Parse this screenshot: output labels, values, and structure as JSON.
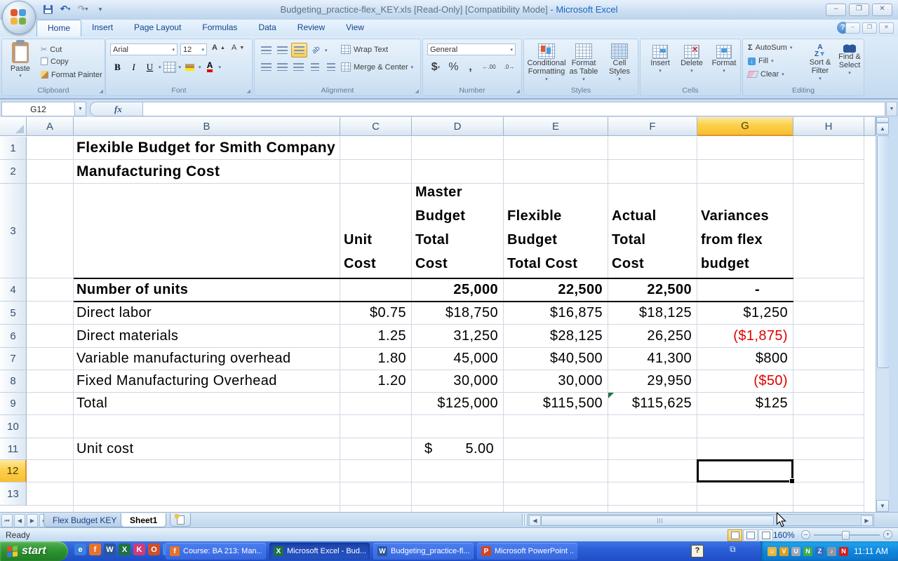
{
  "window": {
    "doc_title": "Budgeting_practice-flex_KEY.xls  [Read-Only]  [Compatibility Mode] ",
    "app_name": "- Microsoft Excel",
    "controls": {
      "minimize": "–",
      "restore": "❐",
      "close": "✕"
    }
  },
  "ribbon_tabs": [
    "Home",
    "Insert",
    "Page Layout",
    "Formulas",
    "Data",
    "Review",
    "View"
  ],
  "active_tab": "Home",
  "ribbon": {
    "clipboard": {
      "label": "Clipboard",
      "paste": "Paste",
      "cut": "Cut",
      "copy": "Copy",
      "format_painter": "Format Painter"
    },
    "font": {
      "label": "Font",
      "family": "Arial",
      "size": "12"
    },
    "alignment": {
      "label": "Alignment",
      "wrap": "Wrap Text",
      "merge": "Merge & Center"
    },
    "number": {
      "label": "Number",
      "format": "General",
      "currency": "$",
      "percent": "%",
      "comma": ",",
      "inc_dec": ".00",
      "dec_dec": ".0"
    },
    "styles": {
      "label": "Styles",
      "conditional": "Conditional\nFormatting",
      "as_table": "Format\nas Table",
      "cell_styles": "Cell\nStyles"
    },
    "cells": {
      "label": "Cells",
      "insert": "Insert",
      "delete": "Delete",
      "format": "Format"
    },
    "editing": {
      "label": "Editing",
      "autosum": "AutoSum",
      "fill": "Fill",
      "clear": "Clear",
      "sort": "Sort &\nFilter",
      "find": "Find &\nSelect"
    }
  },
  "formula_bar": {
    "name_box": "G12",
    "fx": "fx",
    "content": ""
  },
  "sheet": {
    "columns": [
      "A",
      "B",
      "C",
      "D",
      "E",
      "F",
      "G",
      "H"
    ],
    "rows": [
      "1",
      "2",
      "3",
      "4",
      "5",
      "6",
      "7",
      "8",
      "9",
      "10",
      "11",
      "12",
      "13"
    ],
    "active_cell": "G12",
    "active_column": "G",
    "active_row": "12",
    "cells": [
      {
        "r": 1,
        "c": "B",
        "t": "Flexible Budget for Smith Company",
        "cls": "left title"
      },
      {
        "r": 2,
        "c": "B",
        "t": "Manufacturing Cost",
        "cls": "left title"
      },
      {
        "r": 3,
        "c": "C",
        "t": "Unit\nCost",
        "cls": "colhead"
      },
      {
        "r": 3,
        "c": "D",
        "t": "Master\nBudget\nTotal\nCost",
        "cls": "colhead"
      },
      {
        "r": 3,
        "c": "E",
        "t": "Flexible\nBudget\nTotal Cost",
        "cls": "colhead"
      },
      {
        "r": 3,
        "c": "F",
        "t": "Actual\nTotal\nCost",
        "cls": "colhead"
      },
      {
        "r": 3,
        "c": "G",
        "t": "Variances\nfrom flex\nbudget",
        "cls": "colhead"
      },
      {
        "r": 4,
        "c": "B",
        "t": "Number of units",
        "cls": "left bold"
      },
      {
        "r": 4,
        "c": "D",
        "t": "25,000",
        "cls": "num bold"
      },
      {
        "r": 4,
        "c": "E",
        "t": "22,500",
        "cls": "num bold"
      },
      {
        "r": 4,
        "c": "F",
        "t": "22,500",
        "cls": "num bold"
      },
      {
        "r": 4,
        "c": "G",
        "t": "-",
        "cls": "num bold dash"
      },
      {
        "r": 5,
        "c": "B",
        "t": "Direct labor",
        "cls": "left"
      },
      {
        "r": 5,
        "c": "C",
        "t": "$0.75",
        "cls": "num"
      },
      {
        "r": 5,
        "c": "D",
        "t": "$18,750",
        "cls": "num"
      },
      {
        "r": 5,
        "c": "E",
        "t": "$16,875",
        "cls": "num"
      },
      {
        "r": 5,
        "c": "F",
        "t": "$18,125",
        "cls": "num"
      },
      {
        "r": 5,
        "c": "G",
        "t": "$1,250",
        "cls": "num"
      },
      {
        "r": 6,
        "c": "B",
        "t": "Direct materials",
        "cls": "left"
      },
      {
        "r": 6,
        "c": "C",
        "t": "1.25",
        "cls": "num"
      },
      {
        "r": 6,
        "c": "D",
        "t": "31,250",
        "cls": "num"
      },
      {
        "r": 6,
        "c": "E",
        "t": "$28,125",
        "cls": "num"
      },
      {
        "r": 6,
        "c": "F",
        "t": "26,250",
        "cls": "num"
      },
      {
        "r": 6,
        "c": "G",
        "t": "($1,875)",
        "cls": "num red"
      },
      {
        "r": 7,
        "c": "B",
        "t": "Variable manufacturing overhead",
        "cls": "left"
      },
      {
        "r": 7,
        "c": "C",
        "t": "1.80",
        "cls": "num"
      },
      {
        "r": 7,
        "c": "D",
        "t": "45,000",
        "cls": "num"
      },
      {
        "r": 7,
        "c": "E",
        "t": "$40,500",
        "cls": "num"
      },
      {
        "r": 7,
        "c": "F",
        "t": "41,300",
        "cls": "num"
      },
      {
        "r": 7,
        "c": "G",
        "t": "$800",
        "cls": "num"
      },
      {
        "r": 8,
        "c": "B",
        "t": "Fixed Manufacturing Overhead",
        "cls": "left"
      },
      {
        "r": 8,
        "c": "C",
        "t": "1.20",
        "cls": "num"
      },
      {
        "r": 8,
        "c": "D",
        "t": "30,000",
        "cls": "num"
      },
      {
        "r": 8,
        "c": "E",
        "t": "30,000",
        "cls": "num"
      },
      {
        "r": 8,
        "c": "F",
        "t": "29,950",
        "cls": "num"
      },
      {
        "r": 8,
        "c": "G",
        "t": "($50)",
        "cls": "num red"
      },
      {
        "r": 9,
        "c": "B",
        "t": "Total",
        "cls": "left"
      },
      {
        "r": 9,
        "c": "D",
        "t": "$125,000",
        "cls": "num"
      },
      {
        "r": 9,
        "c": "E",
        "t": "$115,500",
        "cls": "num"
      },
      {
        "r": 9,
        "c": "F",
        "t": "$115,625",
        "cls": "num",
        "flag": true
      },
      {
        "r": 9,
        "c": "G",
        "t": "$125",
        "cls": "num"
      },
      {
        "r": 11,
        "c": "B",
        "t": "Unit cost",
        "cls": "left"
      },
      {
        "r": 11,
        "c": "D",
        "t": "5.00",
        "cls": "currency",
        "prefix": "$"
      }
    ]
  },
  "sheet_tabs": {
    "first": "Flex Budget KEY",
    "second": "Sheet1",
    "active": "Sheet1"
  },
  "status_bar": {
    "mode": "Ready",
    "zoom": "160%"
  },
  "taskbar": {
    "start_label": "start",
    "quick_launch": [
      {
        "name": "internet-explorer-icon",
        "glyph": "e",
        "color": "#3a7edb"
      },
      {
        "name": "firefox-icon",
        "glyph": "f",
        "color": "#e8722a"
      },
      {
        "name": "word-icon",
        "glyph": "W",
        "color": "#2b579a"
      },
      {
        "name": "excel-icon",
        "glyph": "X",
        "color": "#1e7145"
      },
      {
        "name": "keys-icon",
        "glyph": "K",
        "color": "#d23a77"
      },
      {
        "name": "outlook-icon",
        "glyph": "O",
        "color": "#d04e2a"
      },
      {
        "name": "messenger-icon",
        "glyph": "e",
        "color": "#4a8ae0"
      }
    ],
    "windows": [
      {
        "label": "Course: BA 213: Man...",
        "icon_glyph": "f",
        "icon_color": "#e8722a",
        "active": false
      },
      {
        "label": "Microsoft Excel - Bud...",
        "icon_glyph": "X",
        "icon_color": "#1e7145",
        "active": true
      },
      {
        "label": "Budgeting_practice-fl...",
        "icon_glyph": "W",
        "icon_color": "#2b579a",
        "active": false
      },
      {
        "label": "Microsoft PowerPoint ...",
        "icon_glyph": "P",
        "icon_color": "#d04525",
        "active": false
      }
    ],
    "help_glyph": "?",
    "tray_icons": [
      {
        "name": "messenger-buddy-icon",
        "glyph": "☺",
        "color": "#e7b73a"
      },
      {
        "name": "antivirus-shield-icon",
        "glyph": "V",
        "color": "#d9a01f"
      },
      {
        "name": "update-icon",
        "glyph": "U",
        "color": "#9aa7b8"
      },
      {
        "name": "network-icon",
        "glyph": "N",
        "color": "#3fae49"
      },
      {
        "name": "zip-icon",
        "glyph": "Z",
        "color": "#2e6fc2"
      },
      {
        "name": "volume-icon",
        "glyph": "♪",
        "color": "#8a97a8"
      },
      {
        "name": "novell-icon",
        "glyph": "N",
        "color": "#cc2222"
      }
    ],
    "clock": "11:11 AM"
  },
  "colors": {
    "negative_value": "#e00000",
    "active_header": "#fbd04a",
    "taskbar_blue": "#2a5fd9",
    "start_green": "#2f9532",
    "flag_green": "#217346"
  }
}
